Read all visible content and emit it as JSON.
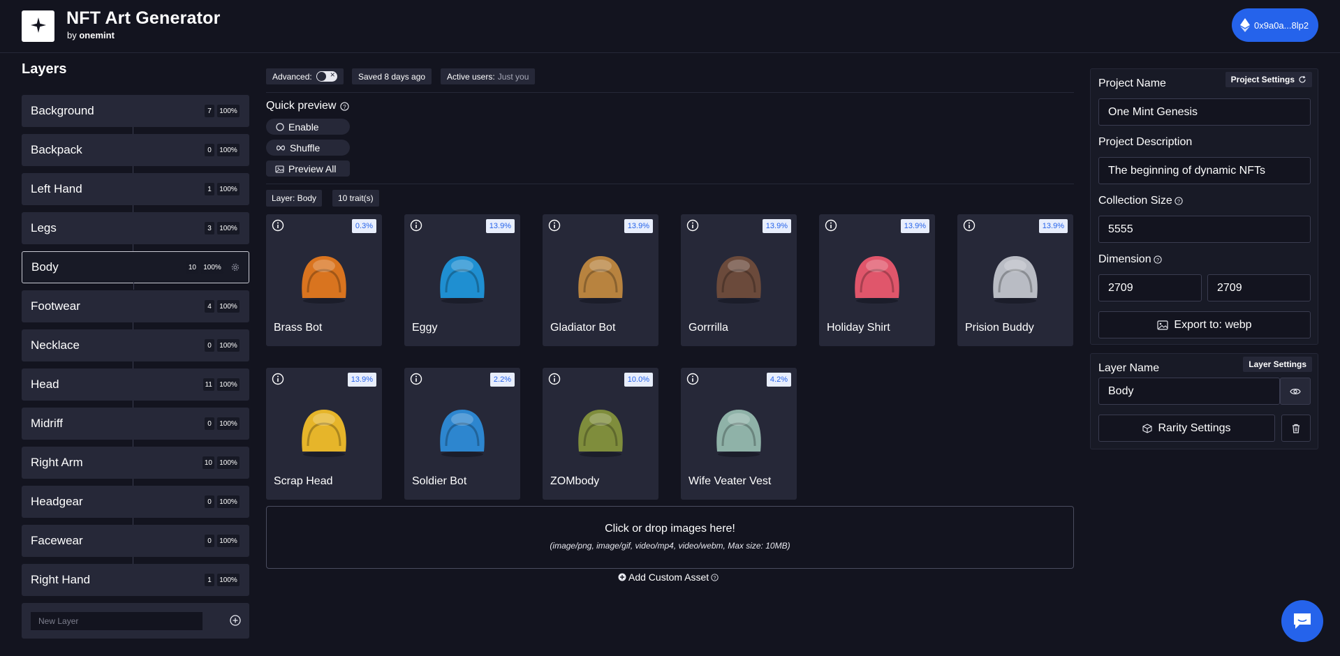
{
  "header": {
    "title": "NFT Art Generator",
    "subtitle_prefix": "by",
    "subtitle_brand": "onemint",
    "wallet": "0x9a0a...8lp2"
  },
  "sidebar": {
    "title": "Layers",
    "new_layer_placeholder": "New Layer",
    "items": [
      {
        "name": "Background",
        "count": "7",
        "pct": "100%"
      },
      {
        "name": "Backpack",
        "count": "0",
        "pct": "100%"
      },
      {
        "name": "Left Hand",
        "count": "1",
        "pct": "100%"
      },
      {
        "name": "Legs",
        "count": "3",
        "pct": "100%"
      },
      {
        "name": "Body",
        "count": "10",
        "pct": "100%"
      },
      {
        "name": "Footwear",
        "count": "4",
        "pct": "100%"
      },
      {
        "name": "Necklace",
        "count": "0",
        "pct": "100%"
      },
      {
        "name": "Head",
        "count": "11",
        "pct": "100%"
      },
      {
        "name": "Midriff",
        "count": "0",
        "pct": "100%"
      },
      {
        "name": "Right Arm",
        "count": "10",
        "pct": "100%"
      },
      {
        "name": "Headgear",
        "count": "0",
        "pct": "100%"
      },
      {
        "name": "Facewear",
        "count": "0",
        "pct": "100%"
      },
      {
        "name": "Right Hand",
        "count": "1",
        "pct": "100%"
      }
    ]
  },
  "toolbar": {
    "advanced_label": "Advanced:",
    "saved": "Saved 8 days ago",
    "active_users_label": "Active users:",
    "active_users_value": "Just you"
  },
  "quick_preview": {
    "title": "Quick preview",
    "enable": "Enable",
    "shuffle": "Shuffle",
    "preview_all": "Preview All"
  },
  "layer_info": {
    "layer": "Layer: Body",
    "traits": "10 trait(s)"
  },
  "traits": [
    {
      "name": "Brass Bot",
      "pct": "0.3%",
      "color": "#d9741f"
    },
    {
      "name": "Eggy",
      "pct": "13.9%",
      "color": "#1f8fd1"
    },
    {
      "name": "Gladiator Bot",
      "pct": "13.9%",
      "color": "#b8833f"
    },
    {
      "name": "Gorrrilla",
      "pct": "13.9%",
      "color": "#6b4a3b"
    },
    {
      "name": "Holiday Shirt",
      "pct": "13.9%",
      "color": "#e0566b"
    },
    {
      "name": "Prision Buddy",
      "pct": "13.9%",
      "color": "#b9bcc4"
    },
    {
      "name": "Scrap Head",
      "pct": "13.9%",
      "color": "#e6b52a"
    },
    {
      "name": "Soldier Bot",
      "pct": "2.2%",
      "color": "#2d86cf"
    },
    {
      "name": "ZOMbody",
      "pct": "10.0%",
      "color": "#7f8d3c"
    },
    {
      "name": "Wife Veater Vest",
      "pct": "4.2%",
      "color": "#8fb2a8"
    }
  ],
  "dropzone": {
    "main": "Click or drop images here!",
    "sub": "(image/png, image/gif, video/mp4, video/webm, Max size: 10MB)",
    "add_custom": "Add Custom Asset"
  },
  "project": {
    "settings_label": "Project Settings",
    "name_label": "Project Name",
    "name": "One Mint Genesis",
    "desc_label": "Project Description",
    "desc": "The beginning of dynamic NFTs",
    "size_label": "Collection Size",
    "size": "5555",
    "dim_label": "Dimension",
    "width": "2709",
    "height": "2709",
    "export": "Export to: webp"
  },
  "layer_settings": {
    "settings_label": "Layer Settings",
    "name_label": "Layer Name",
    "name": "Body",
    "rarity": "Rarity Settings"
  },
  "colors": {
    "accent": "#2563eb",
    "background": "#13141f",
    "card": "#262838"
  }
}
